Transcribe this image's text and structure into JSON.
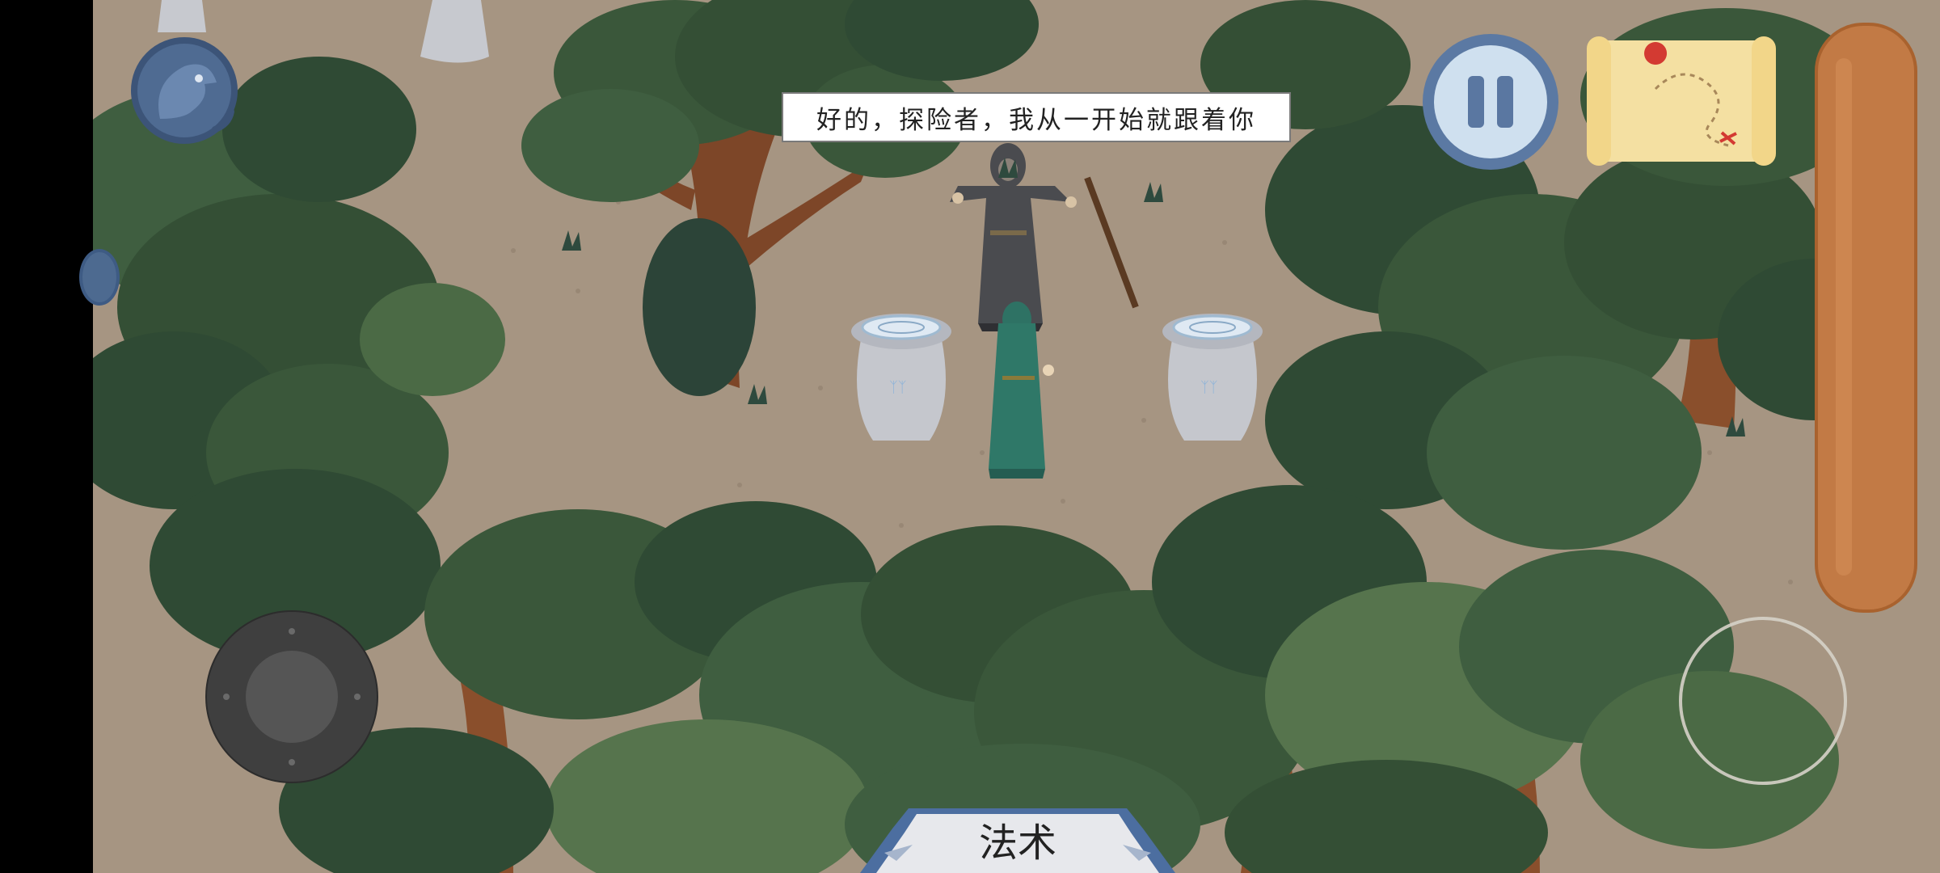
{
  "dialog": {
    "text": "好的，探险者，我从一开始就跟着你"
  },
  "controls": {
    "pause": {
      "icon": "pause-icon"
    },
    "map": {
      "icon": "treasure-map-icon"
    },
    "avatar": {
      "icon": "bird-portrait-icon"
    },
    "joystick": {
      "icon": "joystick-icon"
    },
    "action": {
      "icon": "ring-button-icon"
    }
  },
  "spell_tab": {
    "label": "法术"
  },
  "colors": {
    "ground": "#a69582",
    "foliage_dark": "#2f4a34",
    "foliage_mid": "#3f5e40",
    "foliage_light": "#56744d",
    "trunk": "#8a4f2c",
    "panel": "#c27a45",
    "pause_ring": "#5b79a3"
  }
}
